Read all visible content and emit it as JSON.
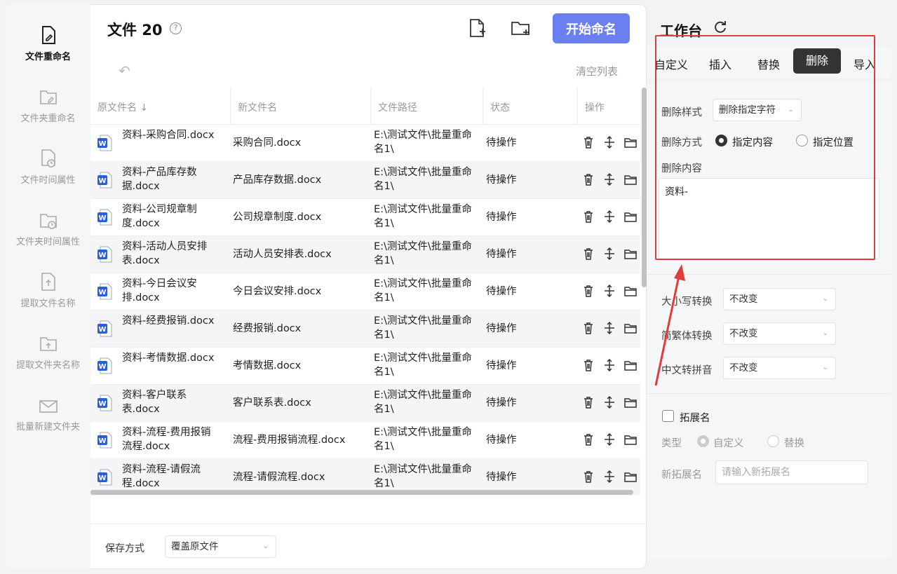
{
  "nav": {
    "items": [
      {
        "label": "文件重命名",
        "icon": "file-edit-icon",
        "active": true
      },
      {
        "label": "文件夹重命名",
        "icon": "folder-edit-icon"
      },
      {
        "label": "文件时间属性",
        "icon": "file-clock-icon"
      },
      {
        "label": "文件夹时间属性",
        "icon": "folder-clock-icon"
      },
      {
        "label": "提取文件名称",
        "icon": "file-extract-icon"
      },
      {
        "label": "提取文件夹名称",
        "icon": "folder-extract-icon"
      },
      {
        "label": "批量新建文件夹",
        "icon": "folder-new-icon"
      }
    ]
  },
  "header": {
    "title": "文件 20",
    "help": "?",
    "start_label": "开始命名",
    "clear_label": "清空列表"
  },
  "table": {
    "columns": [
      "原文件名 ↓",
      "新文件名",
      "文件路径",
      "状态",
      "操作"
    ],
    "rows": [
      {
        "orig": "资料-采购合同.docx",
        "new": "采购合同.docx",
        "path": "E:\\测试文件\\批量重命名1\\",
        "status": "待操作"
      },
      {
        "orig": "资料-产品库存数据.docx",
        "new": "产品库存数据.docx",
        "path": "E:\\测试文件\\批量重命名1\\",
        "status": "待操作"
      },
      {
        "orig": "资料-公司规章制度.docx",
        "new": "公司规章制度.docx",
        "path": "E:\\测试文件\\批量重命名1\\",
        "status": "待操作"
      },
      {
        "orig": "资料-活动人员安排表.docx",
        "new": "活动人员安排表.docx",
        "path": "E:\\测试文件\\批量重命名1\\",
        "status": "待操作"
      },
      {
        "orig": "资料-今日会议安排.docx",
        "new": "今日会议安排.docx",
        "path": "E:\\测试文件\\批量重命名1\\",
        "status": "待操作"
      },
      {
        "orig": "资料-经费报销.docx",
        "new": "经费报销.docx",
        "path": "E:\\测试文件\\批量重命名1\\",
        "status": "待操作"
      },
      {
        "orig": "资料-考情数据.docx",
        "new": "考情数据.docx",
        "path": "E:\\测试文件\\批量重命名1\\",
        "status": "待操作"
      },
      {
        "orig": "资料-客户联系表.docx",
        "new": "客户联系表.docx",
        "path": "E:\\测试文件\\批量重命名1\\",
        "status": "待操作"
      },
      {
        "orig": "资料-流程-费用报销流程.docx",
        "new": "流程-费用报销流程.docx",
        "path": "E:\\测试文件\\批量重命名1\\",
        "status": "待操作"
      },
      {
        "orig": "资料-流程-请假流程.docx",
        "new": "流程-请假流程.docx",
        "path": "E:\\测试文件\\批量重命名1\\",
        "status": "待操作"
      }
    ]
  },
  "footer": {
    "save_label": "保存方式",
    "save_value": "覆盖原文件"
  },
  "workspace": {
    "title": "工作台",
    "tabs": [
      "自定义",
      "插入",
      "替换",
      "删除",
      "导入"
    ],
    "active_tab": "删除",
    "delete_style_label": "删除样式",
    "delete_style_value": "删除指定字符",
    "delete_mode_label": "删除方式",
    "mode_content": "指定内容",
    "mode_position": "指定位置",
    "delete_content_label": "删除内容",
    "delete_content_value": "资料-",
    "case_label": "大小写转换",
    "case_value": "不改变",
    "trad_label": "简繁体转换",
    "trad_value": "不改变",
    "pinyin_label": "中文转拼音",
    "pinyin_value": "不改变",
    "ext_label": "拓展名",
    "type_label": "类型",
    "type_custom": "自定义",
    "type_replace": "替换",
    "new_ext_label": "新拓展名",
    "new_ext_placeholder": "请输入新拓展名"
  },
  "colors": {
    "accent": "#6b7ff0",
    "highlight": "#e23b3b",
    "word_blue": "#2b5fd9"
  }
}
